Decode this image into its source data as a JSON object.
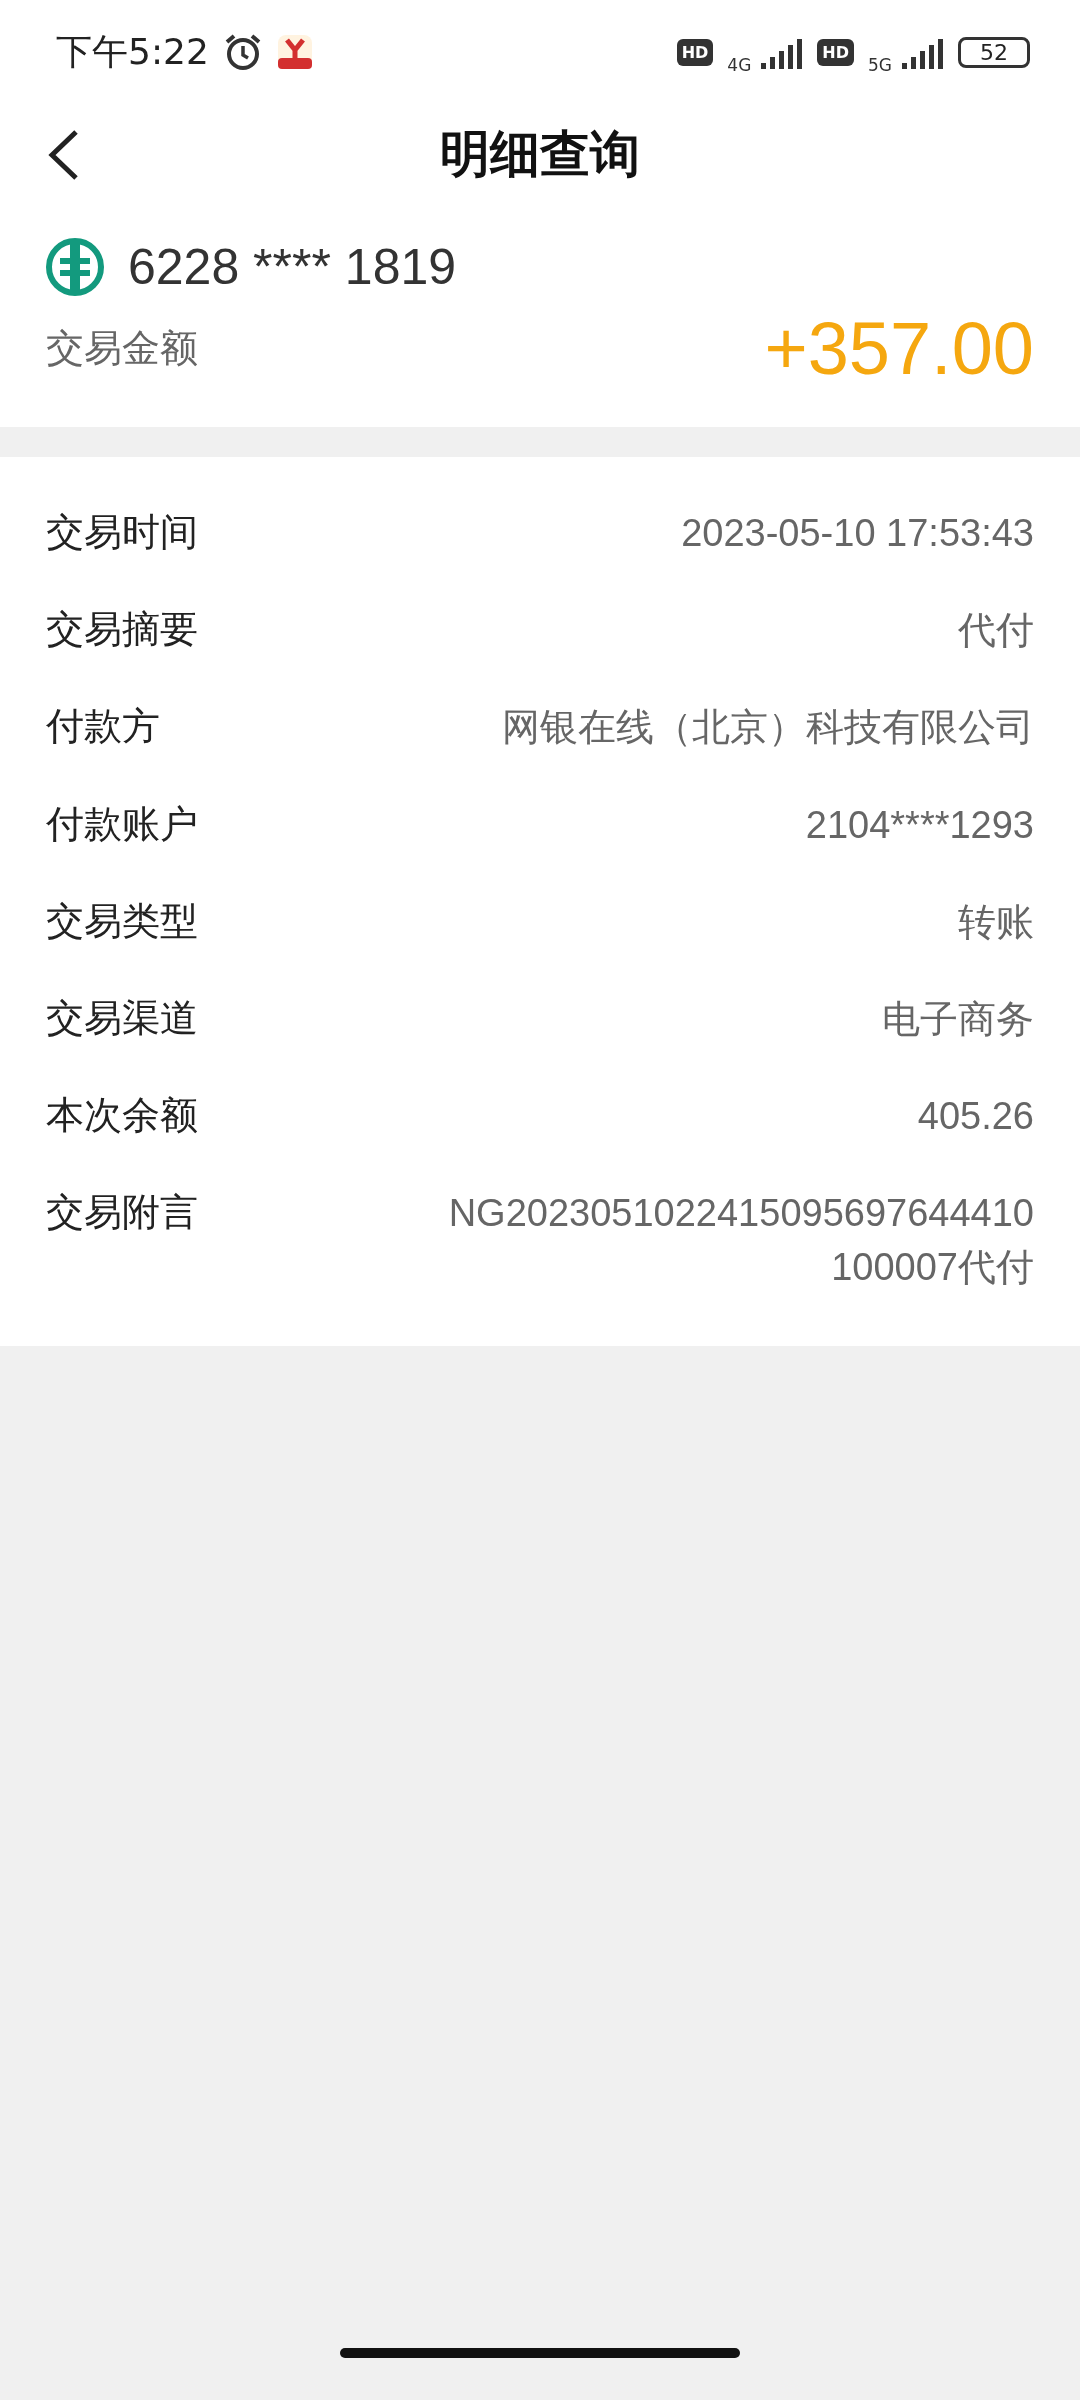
{
  "status_bar": {
    "time": "下午5:22",
    "signals": [
      {
        "badge": "HD",
        "network": "4G"
      },
      {
        "badge": "HD",
        "network": "5G"
      }
    ],
    "battery": "52"
  },
  "header": {
    "title": "明细查询"
  },
  "account": {
    "number": "6228 **** 1819",
    "amount_label": "交易金额",
    "amount": "+357.00"
  },
  "details": [
    {
      "label": "交易时间",
      "value": "2023-05-10 17:53:43"
    },
    {
      "label": "交易摘要",
      "value": "代付"
    },
    {
      "label": "付款方",
      "value": "网银在线（北京）科技有限公司"
    },
    {
      "label": "付款账户",
      "value": "2104****1293"
    },
    {
      "label": "交易类型",
      "value": "转账"
    },
    {
      "label": "交易渠道",
      "value": "电子商务"
    },
    {
      "label": "本次余额",
      "value": "405.26"
    },
    {
      "label": "交易附言",
      "value": "NG2023051022415095697644410100007代付"
    }
  ]
}
